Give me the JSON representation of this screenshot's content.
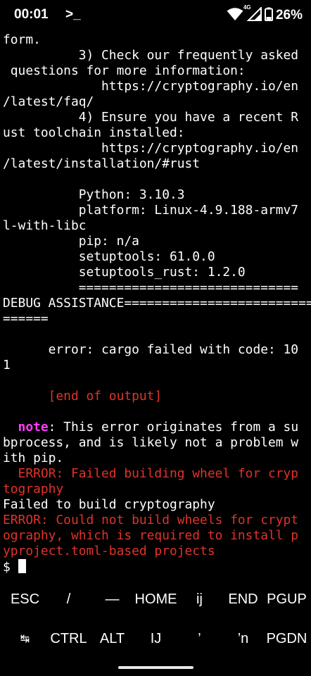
{
  "status_bar": {
    "time": "00:01",
    "terminal_icon": ">_",
    "network_type": "4G",
    "battery": "26%"
  },
  "terminal": {
    "lines": [
      {
        "segments": [
          {
            "text": "form.",
            "color": "white"
          }
        ]
      },
      {
        "segments": [
          {
            "text": "          3) Check our frequently asked",
            "color": "white"
          }
        ]
      },
      {
        "segments": [
          {
            "text": " questions for more information:",
            "color": "white"
          }
        ]
      },
      {
        "segments": [
          {
            "text": "             https://cryptography.io/en",
            "color": "white"
          }
        ]
      },
      {
        "segments": [
          {
            "text": "/latest/faq/",
            "color": "white"
          }
        ]
      },
      {
        "segments": [
          {
            "text": "          4) Ensure you have a recent R",
            "color": "white"
          }
        ]
      },
      {
        "segments": [
          {
            "text": "ust toolchain installed:",
            "color": "white"
          }
        ]
      },
      {
        "segments": [
          {
            "text": "             https://cryptography.io/en",
            "color": "white"
          }
        ]
      },
      {
        "segments": [
          {
            "text": "/latest/installation/#rust",
            "color": "white"
          }
        ]
      },
      {
        "segments": [
          {
            "text": "",
            "color": "white"
          }
        ]
      },
      {
        "segments": [
          {
            "text": "          Python: 3.10.3",
            "color": "white"
          }
        ]
      },
      {
        "segments": [
          {
            "text": "          platform: Linux-4.9.188-armv7",
            "color": "white"
          }
        ]
      },
      {
        "segments": [
          {
            "text": "l-with-libc",
            "color": "white"
          }
        ]
      },
      {
        "segments": [
          {
            "text": "          pip: n/a",
            "color": "white"
          }
        ]
      },
      {
        "segments": [
          {
            "text": "          setuptools: 61.0.0",
            "color": "white"
          }
        ]
      },
      {
        "segments": [
          {
            "text": "          setuptools_rust: 1.2.0",
            "color": "white"
          }
        ]
      },
      {
        "segments": [
          {
            "text": "          =============================",
            "color": "white"
          }
        ]
      },
      {
        "segments": [
          {
            "text": "DEBUG ASSISTANCE=========================",
            "color": "white"
          }
        ]
      },
      {
        "segments": [
          {
            "text": "======",
            "color": "white"
          }
        ]
      },
      {
        "segments": [
          {
            "text": "",
            "color": "white"
          }
        ]
      },
      {
        "segments": [
          {
            "text": "      error: cargo failed with code: 10",
            "color": "white"
          }
        ]
      },
      {
        "segments": [
          {
            "text": "1",
            "color": "white"
          }
        ]
      },
      {
        "segments": [
          {
            "text": "",
            "color": "white"
          }
        ]
      },
      {
        "segments": [
          {
            "text": "      [end of output]",
            "color": "red"
          }
        ]
      },
      {
        "segments": [
          {
            "text": "",
            "color": "white"
          }
        ]
      },
      {
        "segments": [
          {
            "text": "  ",
            "color": "white"
          },
          {
            "text": "note",
            "color": "magenta"
          },
          {
            "text": ": This error originates from a su",
            "color": "white"
          }
        ]
      },
      {
        "segments": [
          {
            "text": "bprocess, and is likely not a problem w",
            "color": "white"
          }
        ]
      },
      {
        "segments": [
          {
            "text": "ith pip.",
            "color": "white"
          }
        ]
      },
      {
        "segments": [
          {
            "text": "  ERROR: Failed building wheel for cryp",
            "color": "red"
          }
        ]
      },
      {
        "segments": [
          {
            "text": "tography",
            "color": "red"
          }
        ]
      },
      {
        "segments": [
          {
            "text": "Failed to build cryptography",
            "color": "white"
          }
        ]
      },
      {
        "segments": [
          {
            "text": "ERROR: Could not build wheels for crypt",
            "color": "red"
          }
        ]
      },
      {
        "segments": [
          {
            "text": "ography, which is required to install p",
            "color": "red"
          }
        ]
      },
      {
        "segments": [
          {
            "text": "yproject.toml-based projects",
            "color": "red"
          }
        ]
      }
    ],
    "prompt": "$ "
  },
  "extra_keys": {
    "row1": [
      "ESC",
      "/",
      "—",
      "HOME",
      "ij",
      "END",
      "PGUP"
    ],
    "row2": [
      "↹",
      "CTRL",
      "ALT",
      "IJ",
      "’",
      "’n",
      "PGDN"
    ]
  },
  "colors": {
    "background": "#000000",
    "text": "#ffffff",
    "error_red": "#e0332a",
    "note_magenta": "#ff3cff"
  }
}
